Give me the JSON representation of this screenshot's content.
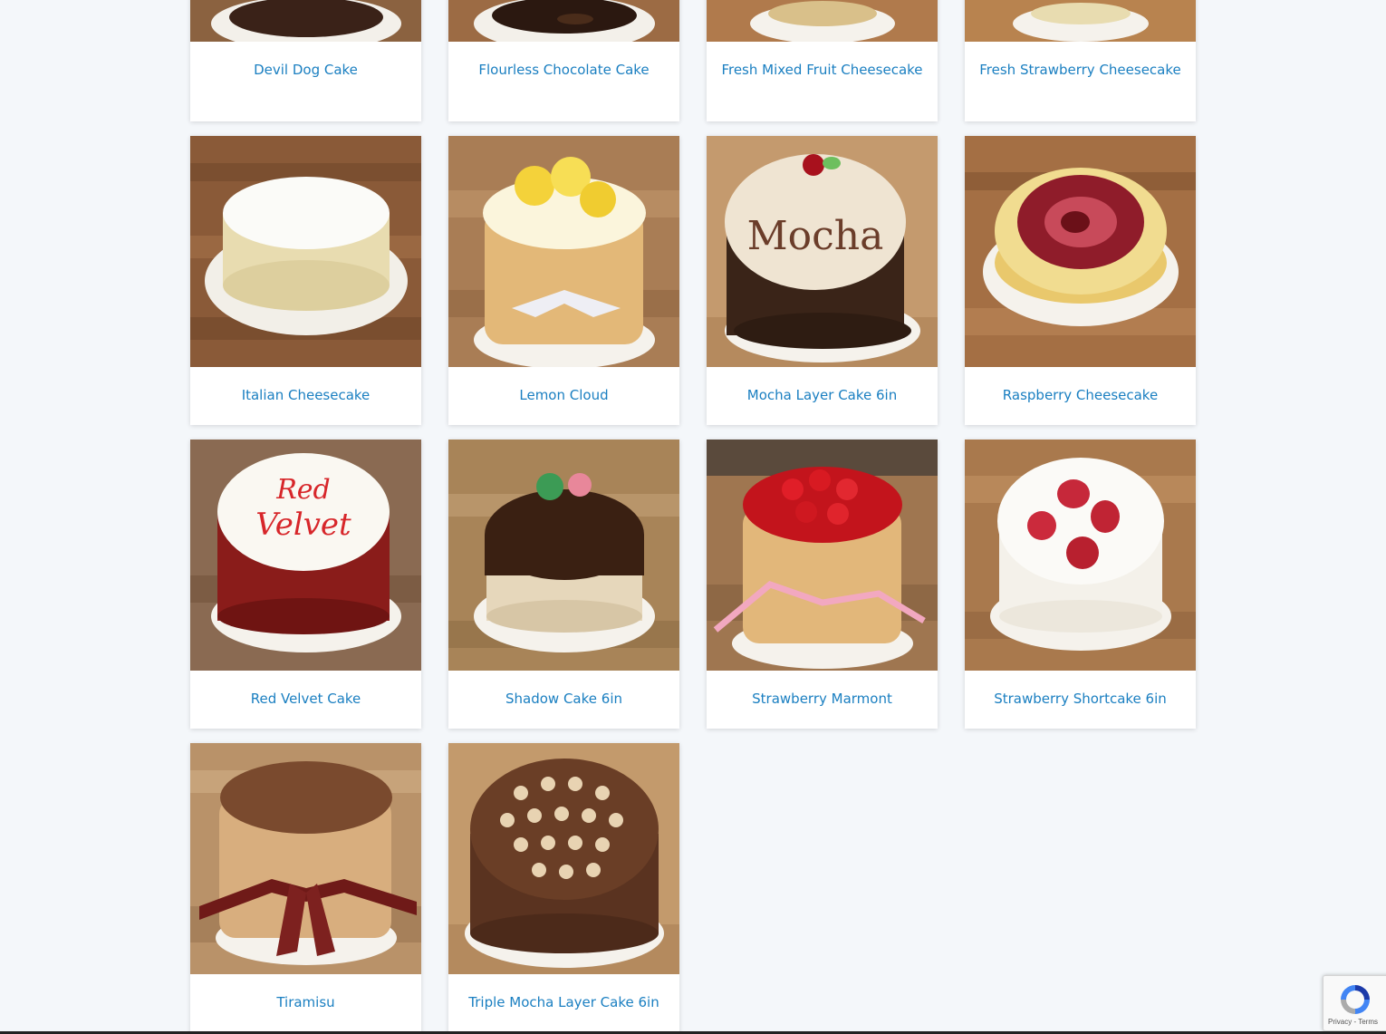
{
  "products": [
    {
      "name": "Devil Dog Cake",
      "image_icon": "devil-dog-cake-photo"
    },
    {
      "name": "Flourless Chocolate Cake",
      "image_icon": "flourless-chocolate-cake-photo"
    },
    {
      "name": "Fresh Mixed Fruit Cheesecake",
      "image_icon": "fresh-mixed-fruit-cheesecake-photo"
    },
    {
      "name": "Fresh Strawberry Cheesecake",
      "image_icon": "fresh-strawberry-cheesecake-photo"
    },
    {
      "name": "Italian Cheesecake",
      "image_icon": "italian-cheesecake-photo"
    },
    {
      "name": "Lemon Cloud",
      "image_icon": "lemon-cloud-photo"
    },
    {
      "name": "Mocha Layer Cake 6in",
      "image_icon": "mocha-layer-cake-photo",
      "cake_writing": "Mocha"
    },
    {
      "name": "Raspberry Cheesecake",
      "image_icon": "raspberry-cheesecake-photo"
    },
    {
      "name": "Red Velvet Cake",
      "image_icon": "red-velvet-cake-photo",
      "cake_writing": "Red Velvet"
    },
    {
      "name": "Shadow Cake 6in",
      "image_icon": "shadow-cake-photo"
    },
    {
      "name": "Strawberry Marmont",
      "image_icon": "strawberry-marmont-photo"
    },
    {
      "name": "Strawberry Shortcake 6in",
      "image_icon": "strawberry-shortcake-photo"
    },
    {
      "name": "Tiramisu",
      "image_icon": "tiramisu-photo"
    },
    {
      "name": "Triple Mocha Layer Cake 6in",
      "image_icon": "triple-mocha-layer-cake-photo"
    }
  ],
  "recaptcha": {
    "privacy_label": "Privacy",
    "separator": " - ",
    "terms_label": "Terms",
    "icon": "recaptcha-logo-icon"
  },
  "colors": {
    "background": "#f4f7fa",
    "link": "#1a7fc1",
    "card": "#ffffff",
    "wood": "#a8744a"
  }
}
